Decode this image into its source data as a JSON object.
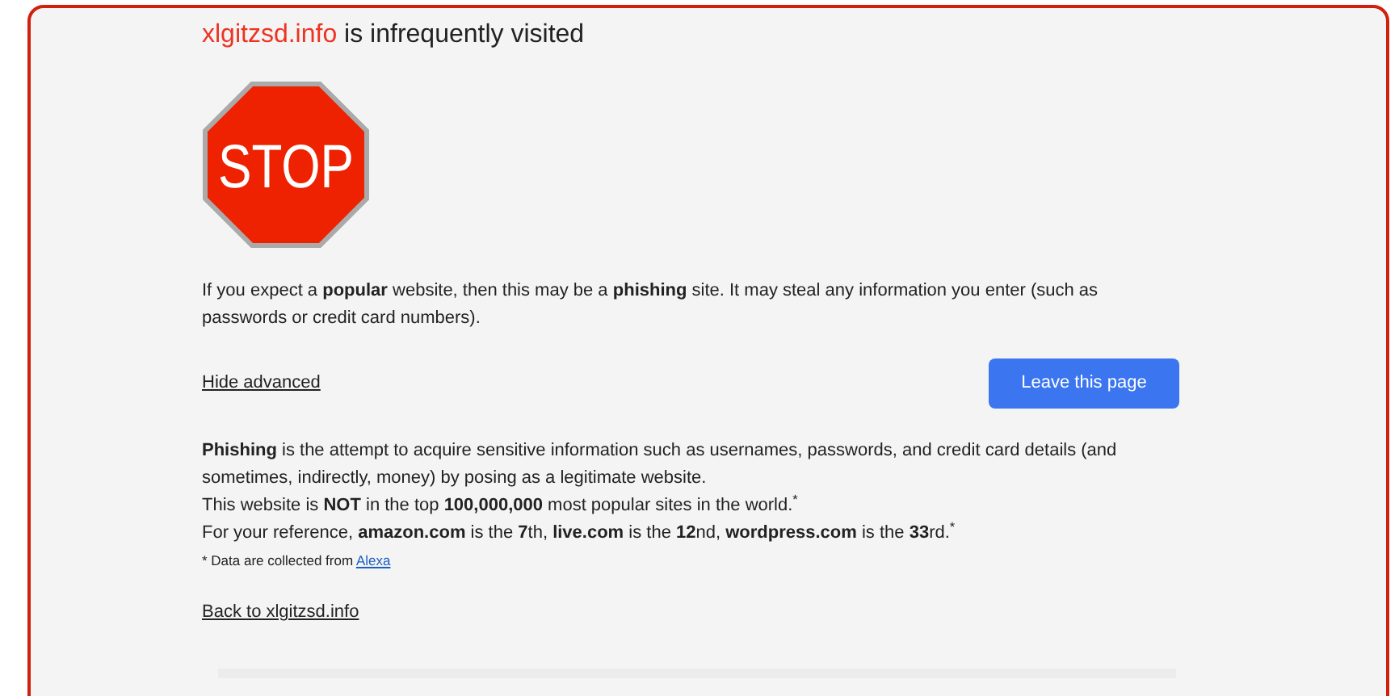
{
  "heading": {
    "domain": "xlgitzsd.info",
    "text": " is infrequently visited"
  },
  "stop_sign": {
    "text": "STOP"
  },
  "warning": "If you expect a **popular** website, then this may be a **phishing** site. It may steal any information you enter (such as passwords or credit card numbers).",
  "hide_advanced_link": "Hide advanced",
  "leave_button": "Leave this page",
  "details": [
    "**Phishing** is the attempt to acquire sensitive information such as usernames, passwords, and credit card details (and sometimes, indirectly, money) by posing as a legitimate website.",
    "This website is **NOT** in the top **100,000,000** most popular sites in the world.$^{*}$",
    "For your reference, **amazon.com** is the **7**th, **live.com** is the **12**nd, **wordpress.com** is the **33**rd.$^{*}$"
  ],
  "footnote": {
    "text": "* Data are collected from ",
    "link": "Alexa"
  },
  "back_link": "Back to xlgitzsd.info"
}
